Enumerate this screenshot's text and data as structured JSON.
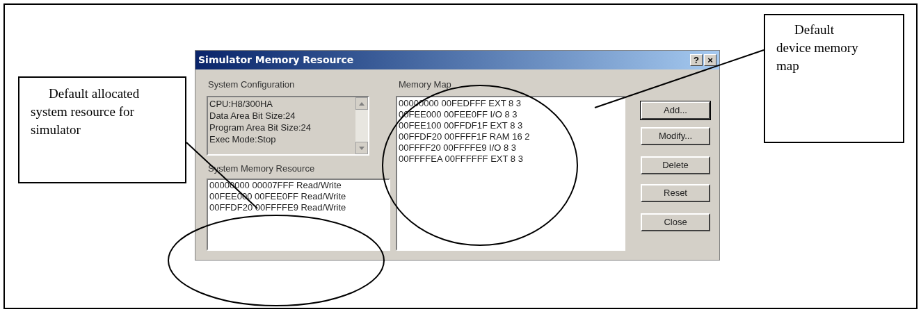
{
  "dialog": {
    "title": "Simulator Memory Resource",
    "title_buttons": [
      "?",
      "×"
    ],
    "system_configuration": {
      "label": "System Configuration",
      "lines": [
        "CPU:H8/300HA",
        "Data Area Bit Size:24",
        "Program Area Bit Size:24",
        "Exec Mode:Stop"
      ]
    },
    "system_memory_resource": {
      "label": "System Memory Resource",
      "lines": [
        "00000000 00007FFF Read/Write",
        "00FEE000 00FEE0FF Read/Write",
        "00FFDF20 00FFFFE9 Read/Write"
      ]
    },
    "memory_map": {
      "label": "Memory Map",
      "lines": [
        "00000000 00FEDFFF EXT 8 3",
        "00FEE000 00FEE0FF I/O 8 3",
        "00FEE100 00FFDF1F EXT 8 3",
        "00FFDF20 00FFFF1F RAM 16 2",
        "00FFFF20 00FFFFE9 I/O 8 3",
        "00FFFFEA 00FFFFFF EXT 8 3"
      ]
    },
    "buttons": [
      "Add...",
      "Modify...",
      "Delete",
      "Reset",
      "Close"
    ]
  },
  "callouts": [
    {
      "text": "Default allocated system resource for simulator"
    },
    {
      "text": "Default device memory map"
    }
  ]
}
